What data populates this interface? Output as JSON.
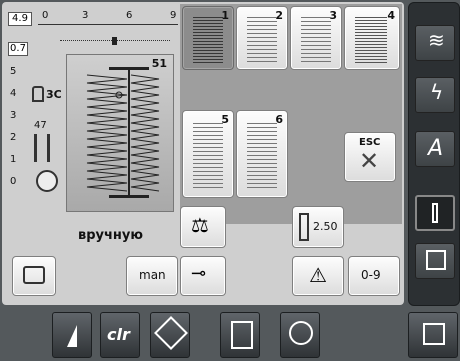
{
  "ruler": {
    "width_value": "4.9",
    "length_value": "0.7",
    "ticks": [
      "0",
      "3",
      "6",
      "9"
    ],
    "side_ticks": [
      "5",
      "4",
      "3",
      "2",
      "1",
      "0"
    ]
  },
  "stitch_preview": {
    "number": "51",
    "presser_foot": "3C",
    "needle_label": "47"
  },
  "mode_label": "вручную",
  "buttons": {
    "man_label": "man",
    "value_250": "2.50",
    "range_label": "0-9",
    "esc_label": "ESC"
  },
  "buttonhole_tiles": [
    {
      "number": "1"
    },
    {
      "number": "2"
    },
    {
      "number": "3"
    },
    {
      "number": "4"
    },
    {
      "number": "5"
    },
    {
      "number": "6"
    }
  ],
  "bottom_bar": {
    "clr_label": "clr"
  },
  "sidebar": {
    "icons": [
      "zigzag-icon",
      "lightning-stitch-icon",
      "alphabet-icon",
      "buttonhole-icon",
      "quilt-icon",
      "menu-icon"
    ],
    "alphabet_label": "A"
  },
  "colors": {
    "background": "#54595c",
    "panel": "#bdbdbd",
    "accent_selected": "#8c8c8c",
    "sidebar": "#2c3033"
  }
}
